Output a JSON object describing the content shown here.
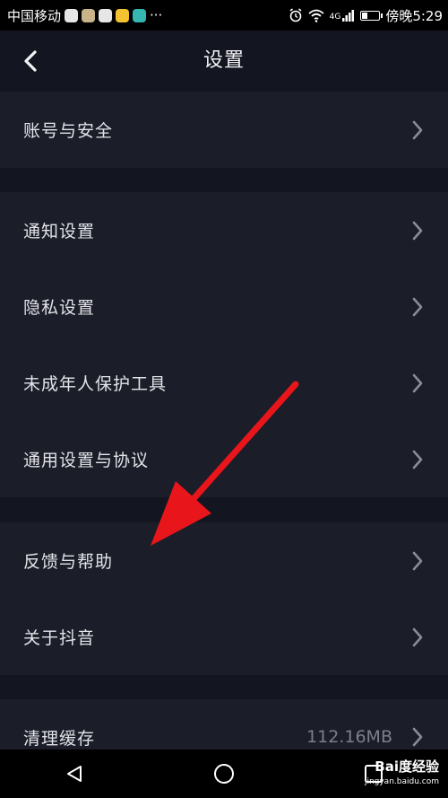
{
  "status_bar": {
    "carrier": "中国移动",
    "more": "···",
    "network": "4G",
    "time": "傍晚5:29",
    "app_icon_colors": [
      "#e6e6e6",
      "#c9b48a",
      "#e6e6e6",
      "#f2c230",
      "#35b6b0"
    ]
  },
  "header": {
    "title": "设置",
    "back_icon": "chevron-left-icon"
  },
  "groups": [
    {
      "items": [
        {
          "label": "账号与安全"
        }
      ]
    },
    {
      "items": [
        {
          "label": "通知设置"
        },
        {
          "label": "隐私设置"
        },
        {
          "label": "未成年人保护工具"
        },
        {
          "label": "通用设置与协议"
        }
      ]
    },
    {
      "items": [
        {
          "label": "反馈与帮助"
        },
        {
          "label": "关于抖音"
        }
      ]
    },
    {
      "items": [
        {
          "label": "清理缓存",
          "value": "112.16MB"
        }
      ]
    }
  ],
  "nav_bar": {
    "back": "triangle-back-icon",
    "home": "circle-home-icon",
    "recents": "square-recents-icon"
  },
  "watermark": {
    "brand": "Bai度经验",
    "url": "jingyan.baidu.com"
  },
  "colors": {
    "background": "#131520",
    "row_background": "#1b1d29",
    "text": "#e3e4e8",
    "secondary_text": "#7d7f88",
    "chevron": "#8a8c95",
    "annotation_arrow": "#e8161b"
  }
}
